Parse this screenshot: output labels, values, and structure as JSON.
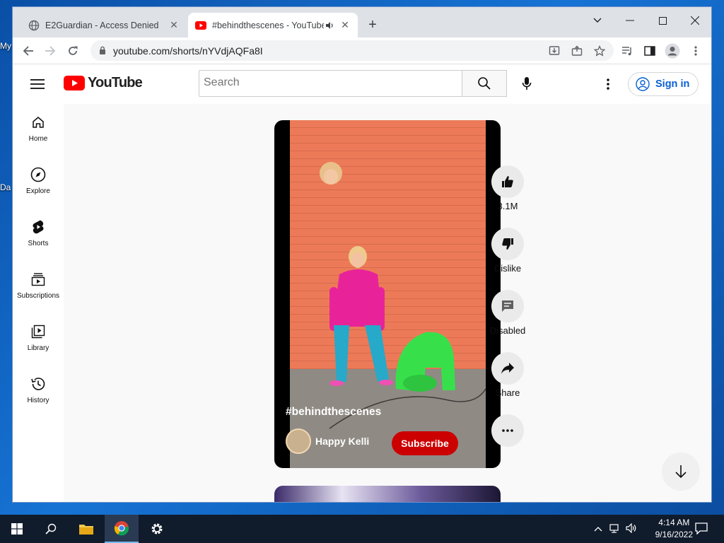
{
  "desktop": {
    "icon_labels": [
      "My",
      "Da"
    ]
  },
  "browser": {
    "tabs": [
      {
        "title": "E2Guardian - Access Denied",
        "favicon": "globe-icon"
      },
      {
        "title": "#behindthescenes - YouTube",
        "favicon": "youtube-icon",
        "audio": "speaker-icon",
        "active": true
      }
    ],
    "url": "youtube.com/shorts/nYVdjAQFa8I"
  },
  "youtube": {
    "logo_text": "YouTube",
    "search_placeholder": "Search",
    "signin_label": "Sign in",
    "guide": [
      {
        "label": "Home",
        "icon": "home-icon"
      },
      {
        "label": "Explore",
        "icon": "compass-icon"
      },
      {
        "label": "Shorts",
        "icon": "shorts-icon"
      },
      {
        "label": "Subscriptions",
        "icon": "subscriptions-icon"
      },
      {
        "label": "Library",
        "icon": "library-icon"
      },
      {
        "label": "History",
        "icon": "history-icon"
      }
    ],
    "short": {
      "title": "#behindthescenes",
      "channel": "Happy Kelli",
      "subscribe_label": "Subscribe"
    },
    "actions": [
      {
        "label": "3.1M",
        "icon": "like-icon"
      },
      {
        "label": "Dislike",
        "icon": "dislike-icon"
      },
      {
        "label": "Disabled",
        "icon": "comment-icon"
      },
      {
        "label": "Share",
        "icon": "share-icon"
      },
      {
        "label": "",
        "icon": "more-icon"
      }
    ]
  },
  "taskbar": {
    "time": "4:14 AM",
    "date": "9/16/2022"
  },
  "colors": {
    "yt_red": "#ff0000",
    "subscribe_red": "#cc0000",
    "signin_blue": "#065fd4"
  }
}
